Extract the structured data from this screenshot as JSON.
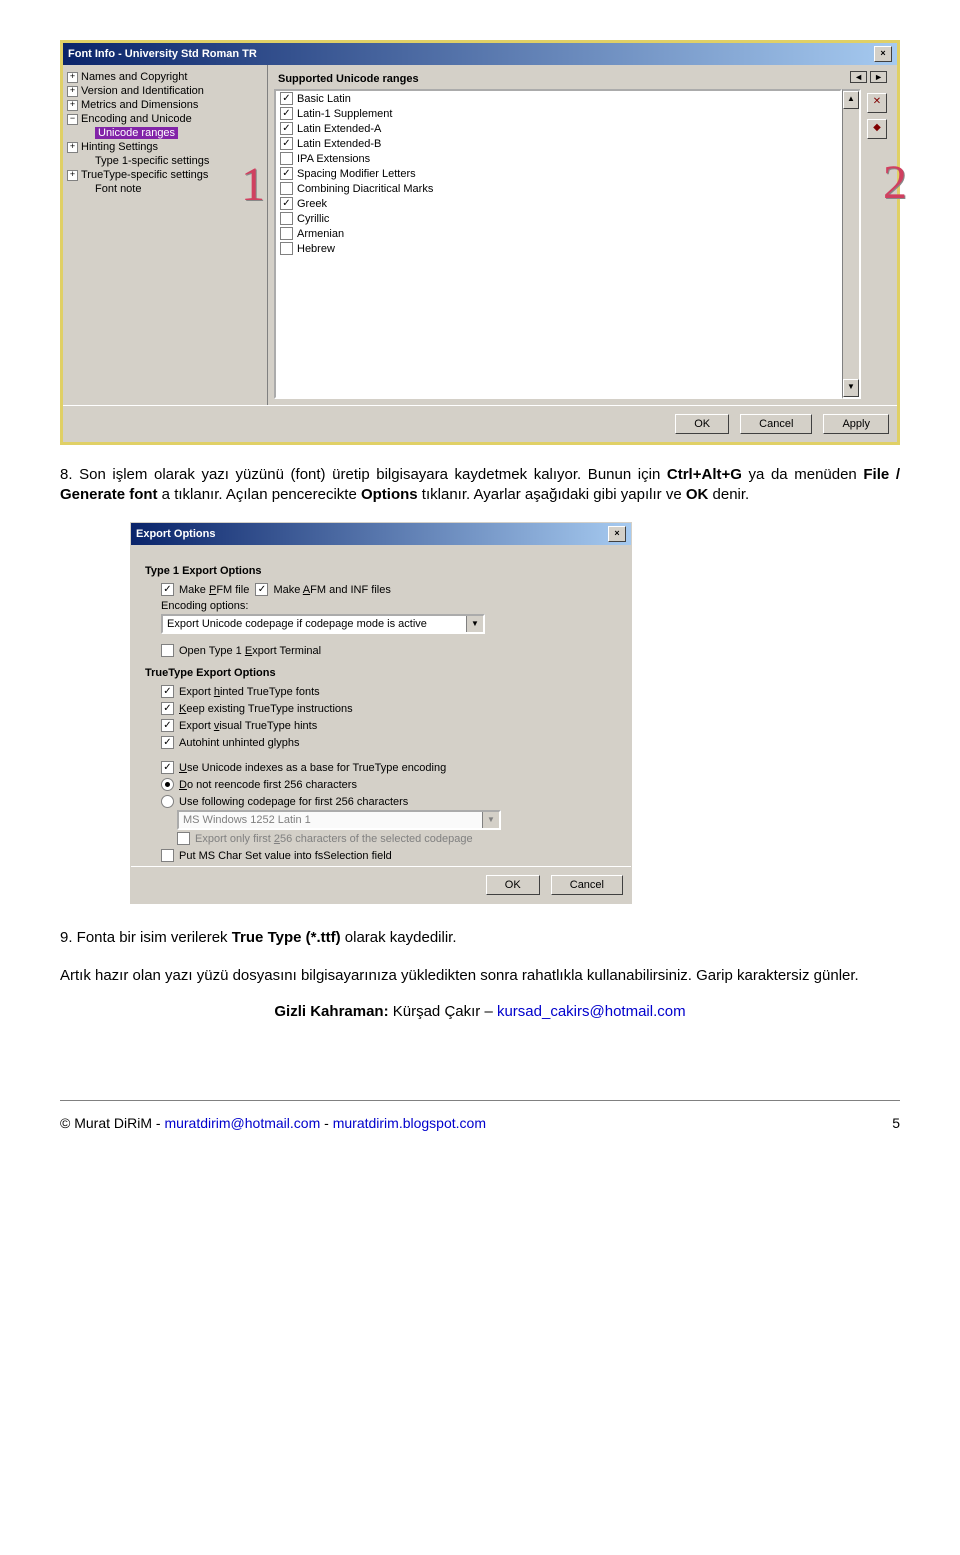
{
  "dialog1": {
    "title": "Font Info - University Std Roman TR",
    "tree": [
      {
        "icon": "plus",
        "label": "Names and Copyright"
      },
      {
        "icon": "plus",
        "label": "Version and Identification"
      },
      {
        "icon": "plus",
        "label": "Metrics and Dimensions"
      },
      {
        "icon": "minus",
        "label": "Encoding and Unicode"
      },
      {
        "icon": "gap",
        "label": "Unicode ranges",
        "selected": true
      },
      {
        "icon": "plus",
        "label": "Hinting Settings"
      },
      {
        "icon": "gap",
        "label": "Type 1-specific settings"
      },
      {
        "icon": "plus",
        "label": "TrueType-specific settings"
      },
      {
        "icon": "gap",
        "label": "Font note"
      }
    ],
    "section": "Supported Unicode ranges",
    "ranges": [
      {
        "label": "Basic Latin",
        "on": true
      },
      {
        "label": "Latin-1 Supplement",
        "on": true
      },
      {
        "label": "Latin Extended-A",
        "on": true
      },
      {
        "label": "Latin Extended-B",
        "on": true
      },
      {
        "label": "IPA Extensions",
        "on": false
      },
      {
        "label": "Spacing Modifier Letters",
        "on": true
      },
      {
        "label": "Combining Diacritical Marks",
        "on": false
      },
      {
        "label": "Greek",
        "on": true
      },
      {
        "label": "Cyrillic",
        "on": false
      },
      {
        "label": "Armenian",
        "on": false
      },
      {
        "label": "Hebrew",
        "on": false
      }
    ],
    "buttons": {
      "ok": "OK",
      "cancel": "Cancel",
      "apply": "Apply"
    }
  },
  "annot": {
    "one": "1",
    "two": "2"
  },
  "para8": {
    "prefix": "8. Son işlem olarak yazı yüzünü (font) üretip bilgisayara kaydetmek kalıyor. Bunun için ",
    "bold1": "Ctrl+Alt+G",
    "mid1": " ya da menüden ",
    "bold2": "File / Generate font",
    "mid2": " a tıklanır. Açılan pencerecikte ",
    "bold3": "Options",
    "mid3": " tıklanır. Ayarlar aşağıdaki gibi yapılır ve ",
    "bold4": "OK",
    "end": " denir."
  },
  "dialog2": {
    "title": "Export Options",
    "g1": "Type 1 Export Options",
    "pfm": "Make PFM file",
    "pfm_u": "P",
    "afm": "Make AFM and INF files",
    "afm_u": "A",
    "enc": "Encoding options:",
    "combo1": "Export Unicode codepage if codepage mode is active",
    "term": "Open Type 1 Export Terminal",
    "term_u": "E",
    "g2": "TrueType Export Options",
    "tt1": "Export hinted TrueType fonts",
    "tt1_u": "h",
    "tt2": "Keep existing TrueType instructions",
    "tt2_u": "K",
    "tt3": "Export visual TrueType hints",
    "tt3_u": "v",
    "tt4": "Autohint unhinted glyphs",
    "uni": "Use Unicode indexes as a base for TrueType encoding",
    "uni_u": "U",
    "r1": "Do not reencode first 256 characters",
    "r1_u": "D",
    "r2": "Use following codepage for first 256 characters",
    "combo2": "MS Windows 1252 Latin 1",
    "only": "Export only first 256 characters of the selected codepage",
    "only_u": "2",
    "put": "Put MS Char Set value into fsSelection field",
    "ok": "OK",
    "cancel": "Cancel"
  },
  "para9": {
    "prefix": "9. Fonta bir isim verilerek ",
    "bold": "True Type (*.ttf)",
    "end": " olarak kaydedilir."
  },
  "para10": "Artık hazır olan yazı yüzü dosyasını bilgisayarınıza yükledikten sonra rahatlıkla kullanabilirsiniz. Garip karaktersiz günler.",
  "gizli": {
    "lead": "Gizli Kahraman: ",
    "name": "Kürşad Çakır – ",
    "mail": "kursad_cakirs@hotmail.com"
  },
  "footer": {
    "copy": "© Murat DiRiM - ",
    "mail": "muratdirim@hotmail.com",
    "sep": " - ",
    "blog": "muratdirim.blogspot.com",
    "page": "5"
  }
}
